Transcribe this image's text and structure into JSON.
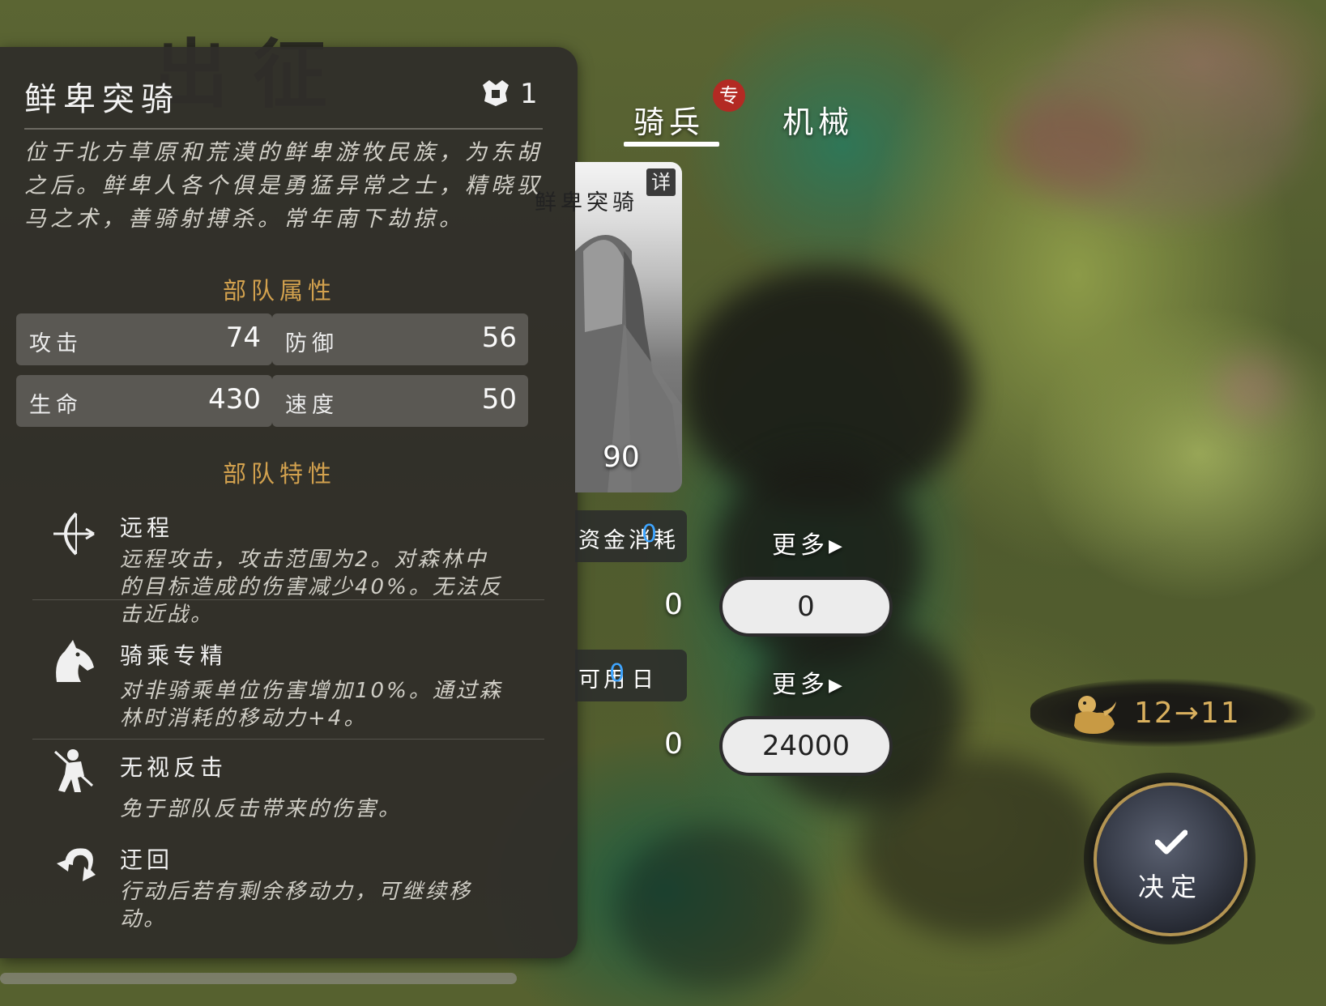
{
  "background_title": "出征",
  "unit": {
    "name": "鲜卑突骑",
    "count": "1",
    "description": "位于北方草原和荒漠的鲜卑游牧民族，为东胡之后。鲜卑人各个俱是勇猛异常之士，精晓驭马之术，善骑射搏杀。常年南下劫掠。"
  },
  "attributes": {
    "title": "部队属性",
    "items": [
      {
        "label": "攻击",
        "value": "74"
      },
      {
        "label": "防御",
        "value": "56"
      },
      {
        "label": "生命",
        "value": "430"
      },
      {
        "label": "速度",
        "value": "50"
      }
    ]
  },
  "traits": {
    "title": "部队特性",
    "items": [
      {
        "name": "远程",
        "icon": "bow-icon",
        "desc": "远程攻击，攻击范围为2。对森林中的目标造成的伤害减少40%。无法反击近战。"
      },
      {
        "name": "骑乘专精",
        "icon": "horse-head-icon",
        "desc": "对非骑乘单位伤害增加10%。通过森林时消耗的移动力+4。"
      },
      {
        "name": "无视反击",
        "icon": "warrior-icon",
        "desc": "免于部队反击带来的伤害。"
      },
      {
        "name": "迂回",
        "icon": "turn-arrow-icon",
        "desc": "行动后若有剩余移动力，可继续移动。"
      }
    ]
  },
  "tabs": [
    {
      "label": "骑兵",
      "active": true,
      "badge": "专"
    },
    {
      "label": "机械",
      "active": false
    }
  ],
  "card": {
    "name": "鲜卑突骑",
    "detail": "详",
    "cost": "90"
  },
  "resources": {
    "funds_label": "资金消耗",
    "funds_value": "0",
    "days_prefix": "可用",
    "days_value": "0",
    "days_suffix": "日",
    "more_label": "更多",
    "row1_left": "0",
    "row1_input": "0",
    "row2_left": "0",
    "row2_input": "24000"
  },
  "turn": {
    "text": "12→11"
  },
  "confirm": {
    "label": "决定"
  },
  "colors": {
    "accent_gold": "#d2a14e",
    "highlight_blue": "#3ea5ff",
    "badge_red": "#b32a23"
  }
}
